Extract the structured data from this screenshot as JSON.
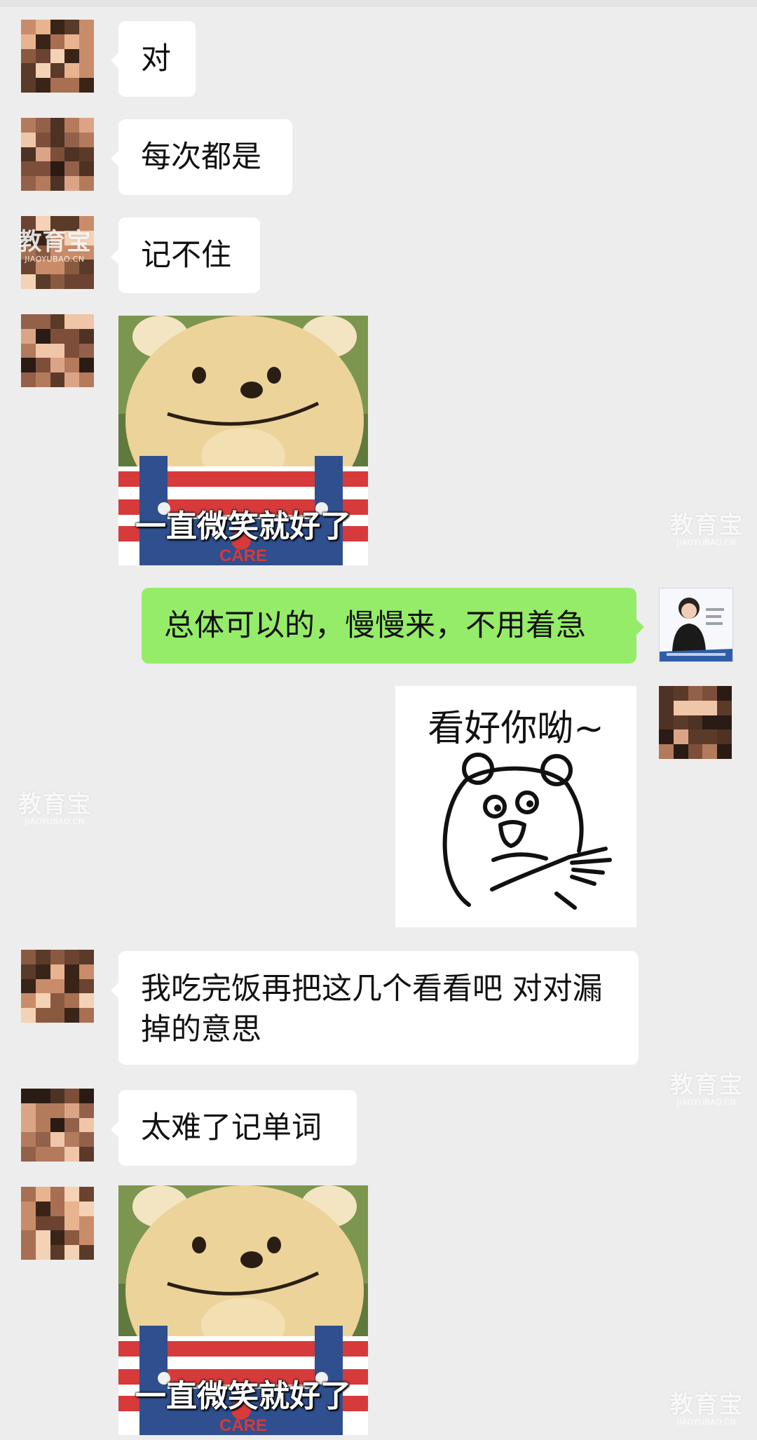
{
  "colors": {
    "background": "#ededed",
    "bubble_received": "#ffffff",
    "bubble_sent": "#95ec69"
  },
  "messages": [
    {
      "side": "left",
      "type": "text",
      "text": "对"
    },
    {
      "side": "left",
      "type": "text",
      "text": "每次都是"
    },
    {
      "side": "left",
      "type": "text",
      "text": "记不住"
    },
    {
      "side": "left",
      "type": "sticker",
      "sticker": "smiling-teddy-bear",
      "caption": "一直微笑就好了"
    },
    {
      "side": "right",
      "type": "text",
      "text": "总体可以的，慢慢来，不用着急"
    },
    {
      "side": "right",
      "type": "sticker",
      "sticker": "pointing-bear-drawing",
      "caption": "看好你呦~"
    },
    {
      "side": "left",
      "type": "text",
      "text": "我吃完饭再把这几个看看吧 对对漏掉的意思"
    },
    {
      "side": "left",
      "type": "text",
      "text": "太难了记单词"
    },
    {
      "side": "left",
      "type": "sticker",
      "sticker": "smiling-teddy-bear",
      "caption": "一直微笑就好了"
    }
  ],
  "teddy_shirt_text": "CARE",
  "watermark": {
    "cn": "教育宝",
    "en": "JIAOYUBAO.CN"
  }
}
